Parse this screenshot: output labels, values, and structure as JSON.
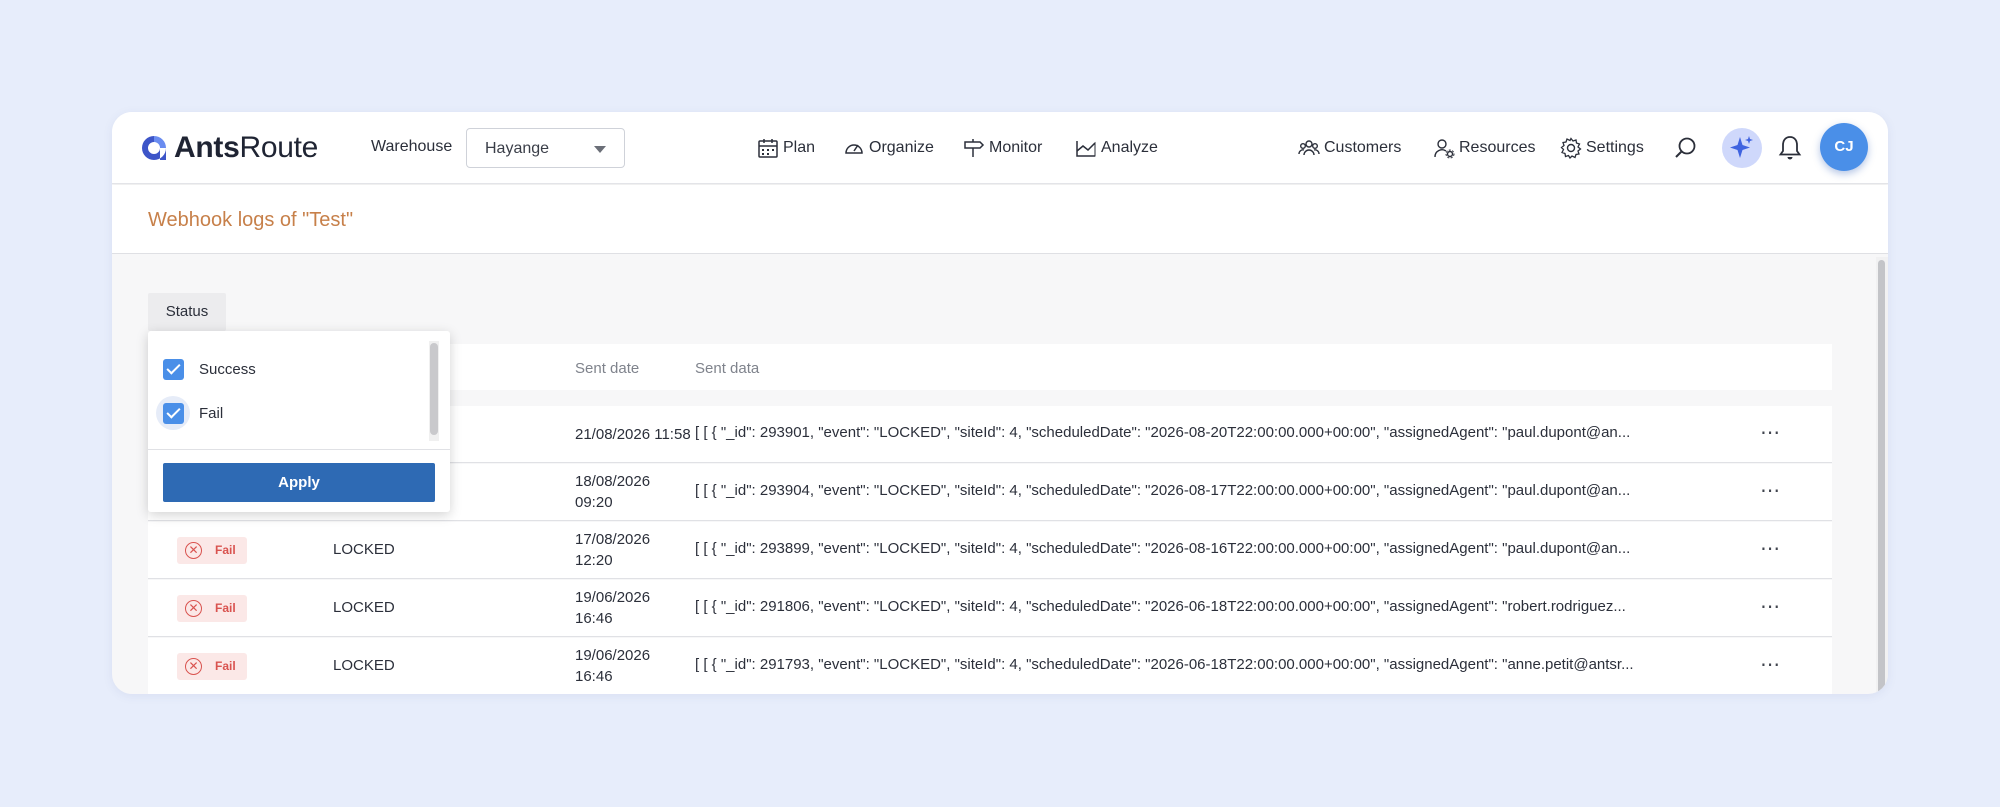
{
  "brand": {
    "name_bold": "Ants",
    "name_rest": "Route"
  },
  "header": {
    "warehouse_label": "Warehouse",
    "warehouse_value": "Hayange",
    "nav": [
      {
        "label": "Plan",
        "icon": "calendar-icon"
      },
      {
        "label": "Organize",
        "icon": "gauge-icon"
      },
      {
        "label": "Monitor",
        "icon": "signpost-icon"
      },
      {
        "label": "Analyze",
        "icon": "chart-icon"
      }
    ],
    "right_nav": [
      {
        "label": "Customers",
        "icon": "customers-icon"
      },
      {
        "label": "Resources",
        "icon": "resources-icon"
      },
      {
        "label": "Settings",
        "icon": "gear-icon"
      }
    ],
    "avatar_initials": "CJ"
  },
  "page": {
    "title": "Webhook logs of \"Test\""
  },
  "filter": {
    "status_label": "Status",
    "options": [
      {
        "label": "Success",
        "checked": true
      },
      {
        "label": "Fail",
        "checked": true
      }
    ],
    "apply_label": "Apply"
  },
  "table": {
    "columns": {
      "sent_date": "Sent date",
      "sent_data": "Sent data"
    },
    "rows": [
      {
        "status": "",
        "event": "",
        "date1": "21/08/2026 11:58",
        "date2": "",
        "data": "[ [ { \"_id\": 293901, \"event\": \"LOCKED\", \"siteId\": 4, \"scheduledDate\": \"2026-08-20T22:00:00.000+00:00\", \"assignedAgent\": \"paul.dupont@an..."
      },
      {
        "status": "",
        "event": "",
        "date1": "18/08/2026",
        "date2": "09:20",
        "data": "[ [ { \"_id\": 293904, \"event\": \"LOCKED\", \"siteId\": 4, \"scheduledDate\": \"2026-08-17T22:00:00.000+00:00\", \"assignedAgent\": \"paul.dupont@an..."
      },
      {
        "status": "Fail",
        "event": "LOCKED",
        "date1": "17/08/2026",
        "date2": "12:20",
        "data": "[ [ { \"_id\": 293899, \"event\": \"LOCKED\", \"siteId\": 4, \"scheduledDate\": \"2026-08-16T22:00:00.000+00:00\", \"assignedAgent\": \"paul.dupont@an..."
      },
      {
        "status": "Fail",
        "event": "LOCKED",
        "date1": "19/06/2026",
        "date2": "16:46",
        "data": "[ [ { \"_id\": 291806, \"event\": \"LOCKED\", \"siteId\": 4, \"scheduledDate\": \"2026-06-18T22:00:00.000+00:00\", \"assignedAgent\": \"robert.rodriguez..."
      },
      {
        "status": "Fail",
        "event": "LOCKED",
        "date1": "19/06/2026",
        "date2": "16:46",
        "data": "[ [ { \"_id\": 291793, \"event\": \"LOCKED\", \"siteId\": 4, \"scheduledDate\": \"2026-06-18T22:00:00.000+00:00\", \"assignedAgent\": \"anne.petit@antsr..."
      }
    ],
    "more_label": "⋯"
  },
  "colors": {
    "accent": "#4a8fe8",
    "apply": "#2e6ab4",
    "title": "#c7804a",
    "fail": "#d9534f"
  }
}
